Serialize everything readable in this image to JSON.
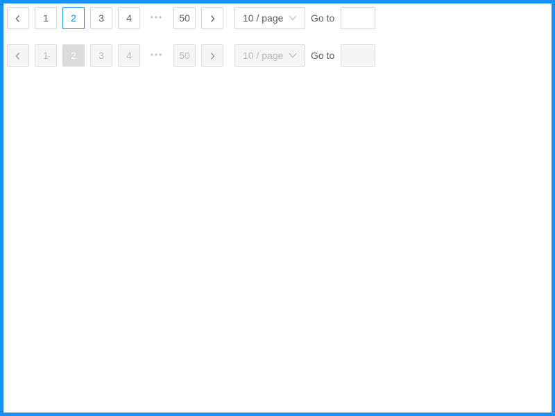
{
  "colors": {
    "frame_border": "#1890ff",
    "accent": "#1890ff",
    "item_border": "#d9d9d9",
    "disabled_bg": "#f5f5f5",
    "disabled_active_bg": "#dbdbdb"
  },
  "paginations": [
    {
      "state": "enabled",
      "prev_icon": "chevron-left-icon",
      "pages": [
        "1",
        "2",
        "3",
        "4"
      ],
      "current_page": "2",
      "ellipsis": "•••",
      "last_page": "50",
      "next_icon": "chevron-right-icon",
      "page_size": {
        "value": "10 / page",
        "icon": "chevron-down-icon"
      },
      "goto": {
        "label": "Go to",
        "value": "",
        "placeholder": ""
      }
    },
    {
      "state": "disabled",
      "prev_icon": "chevron-left-icon",
      "pages": [
        "1",
        "2",
        "3",
        "4"
      ],
      "current_page": "2",
      "ellipsis": "•••",
      "last_page": "50",
      "next_icon": "chevron-right-icon",
      "page_size": {
        "value": "10 / page",
        "icon": "chevron-down-icon"
      },
      "goto": {
        "label": "Go to",
        "value": "",
        "placeholder": ""
      }
    }
  ]
}
